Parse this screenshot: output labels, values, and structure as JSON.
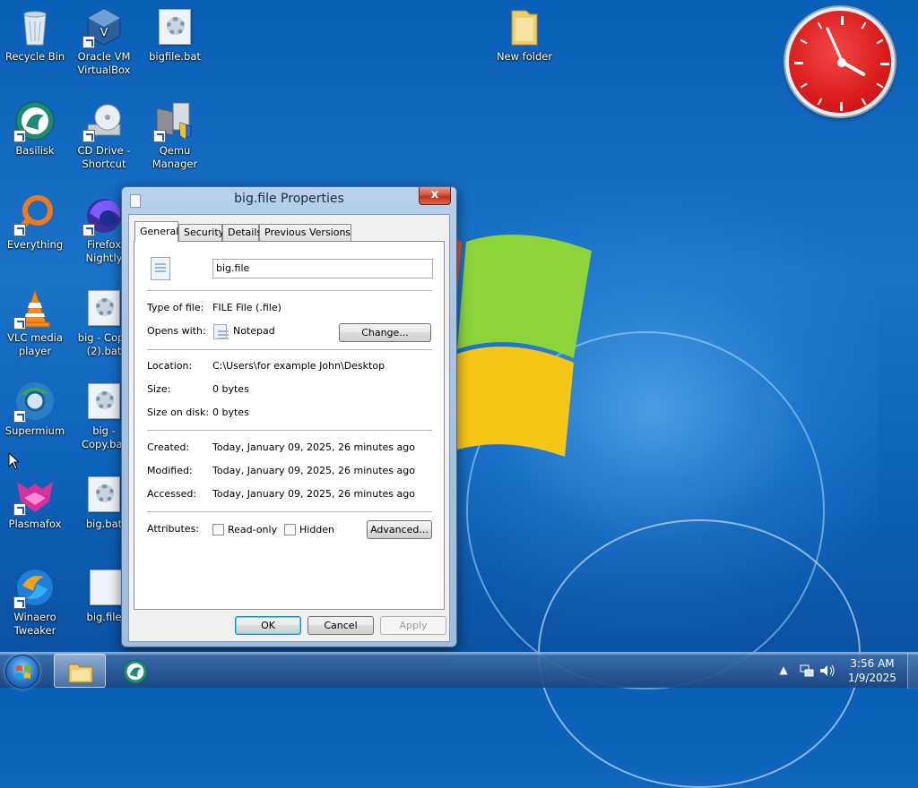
{
  "desktop": {
    "icons": [
      {
        "label": "Recycle Bin"
      },
      {
        "label": "Oracle VM VirtualBox"
      },
      {
        "label": "bigfile.bat"
      },
      {
        "label": "New folder"
      },
      {
        "label": "Basilisk"
      },
      {
        "label": "CD Drive - Shortcut"
      },
      {
        "label": "Qemu Manager"
      },
      {
        "label": "Everything"
      },
      {
        "label": "Firefox Nightly"
      },
      {
        "label": "VLC media player"
      },
      {
        "label": "big - Copy (2).bat"
      },
      {
        "label": "Supermium"
      },
      {
        "label": "big - Copy.bat"
      },
      {
        "label": "Plasmafox"
      },
      {
        "label": "big.bat"
      },
      {
        "label": "Winaero Tweaker"
      },
      {
        "label": "big.file"
      }
    ]
  },
  "dialog": {
    "title": "big.file Properties",
    "close_label": "x",
    "tabs": [
      {
        "label": "General"
      },
      {
        "label": "Security"
      },
      {
        "label": "Details"
      },
      {
        "label": "Previous Versions"
      }
    ],
    "file_name": "big.file",
    "type_label": "Type of file:",
    "type_value": "FILE File (.file)",
    "opens_label": "Opens with:",
    "opens_value": "Notepad",
    "change_label": "Change...",
    "location_label": "Location:",
    "location_value": "C:\\Users\\for example John\\Desktop",
    "size_label": "Size:",
    "size_value": "0 bytes",
    "size_disk_label": "Size on disk:",
    "size_disk_value": "0 bytes",
    "created_label": "Created:",
    "created_value": "Today, January 09, 2025, 26 minutes ago",
    "modified_label": "Modified:",
    "modified_value": "Today, January 09, 2025, 26 minutes ago",
    "accessed_label": "Accessed:",
    "accessed_value": "Today, January 09, 2025, 26 minutes ago",
    "attributes_label": "Attributes:",
    "readonly_label": "Read-only",
    "hidden_label": "Hidden",
    "advanced_label": "Advanced...",
    "ok_label": "OK",
    "cancel_label": "Cancel",
    "apply_label": "Apply"
  },
  "taskbar": {
    "time": "3:56 AM",
    "date": "1/9/2025"
  },
  "colors": {
    "desktop": "#1a73c8",
    "clock_face": "#d91c1c"
  }
}
